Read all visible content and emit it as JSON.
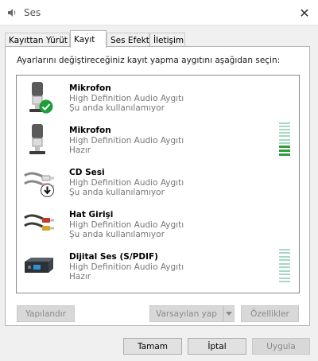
{
  "window": {
    "title": "Ses",
    "icon": "speaker-icon",
    "close_glyph": "✕"
  },
  "tabs": [
    {
      "label": "Kayıttan Yürüt",
      "active": false
    },
    {
      "label": "Kayıt",
      "active": true
    },
    {
      "label": "Ses Efekti",
      "active": false
    },
    {
      "label": "İletişim",
      "active": false
    }
  ],
  "instruction": "Ayarlarını değiştireceğiniz kayıt yapma aygıtını aşağıdan seçin:",
  "devices": [
    {
      "name": "Mikrofon",
      "driver": "High Definition Audio Aygıtı",
      "status": "Şu anda kullanılamıyor",
      "icon": "microphone-icon",
      "badge": "default-check-icon",
      "level_bars_lit": 0
    },
    {
      "name": "Mikrofon",
      "driver": "High Definition Audio Aygıtı",
      "status": "Hazır",
      "icon": "microphone-icon",
      "badge": "",
      "level_bars_lit": 3
    },
    {
      "name": "CD Sesi",
      "driver": "High Definition Audio Aygıtı",
      "status": "Şu anda kullanılamıyor",
      "icon": "rca-cable-icon",
      "badge": "unplugged-arrow-icon",
      "level_bars_lit": 0
    },
    {
      "name": "Hat Girişi",
      "driver": "High Definition Audio Aygıtı",
      "status": "Şu anda kullanılamıyor",
      "icon": "line-in-cable-icon",
      "badge": "",
      "level_bars_lit": 0
    },
    {
      "name": "Dijital Ses (S/PDIF)",
      "driver": "High Definition Audio Aygıtı",
      "status": "Hazır",
      "icon": "spdif-device-icon",
      "badge": "",
      "level_bars_lit": 0
    }
  ],
  "buttons": {
    "configure": "Yapılandır",
    "set_default": "Varsayılan yap",
    "properties": "Özellikler",
    "ok": "Tamam",
    "cancel": "İptal",
    "apply": "Uygula"
  },
  "colors": {
    "default_badge": "#1e9e3a",
    "meter_lit": "#2e9e3e",
    "meter_unlit": "#a8d8c4"
  }
}
